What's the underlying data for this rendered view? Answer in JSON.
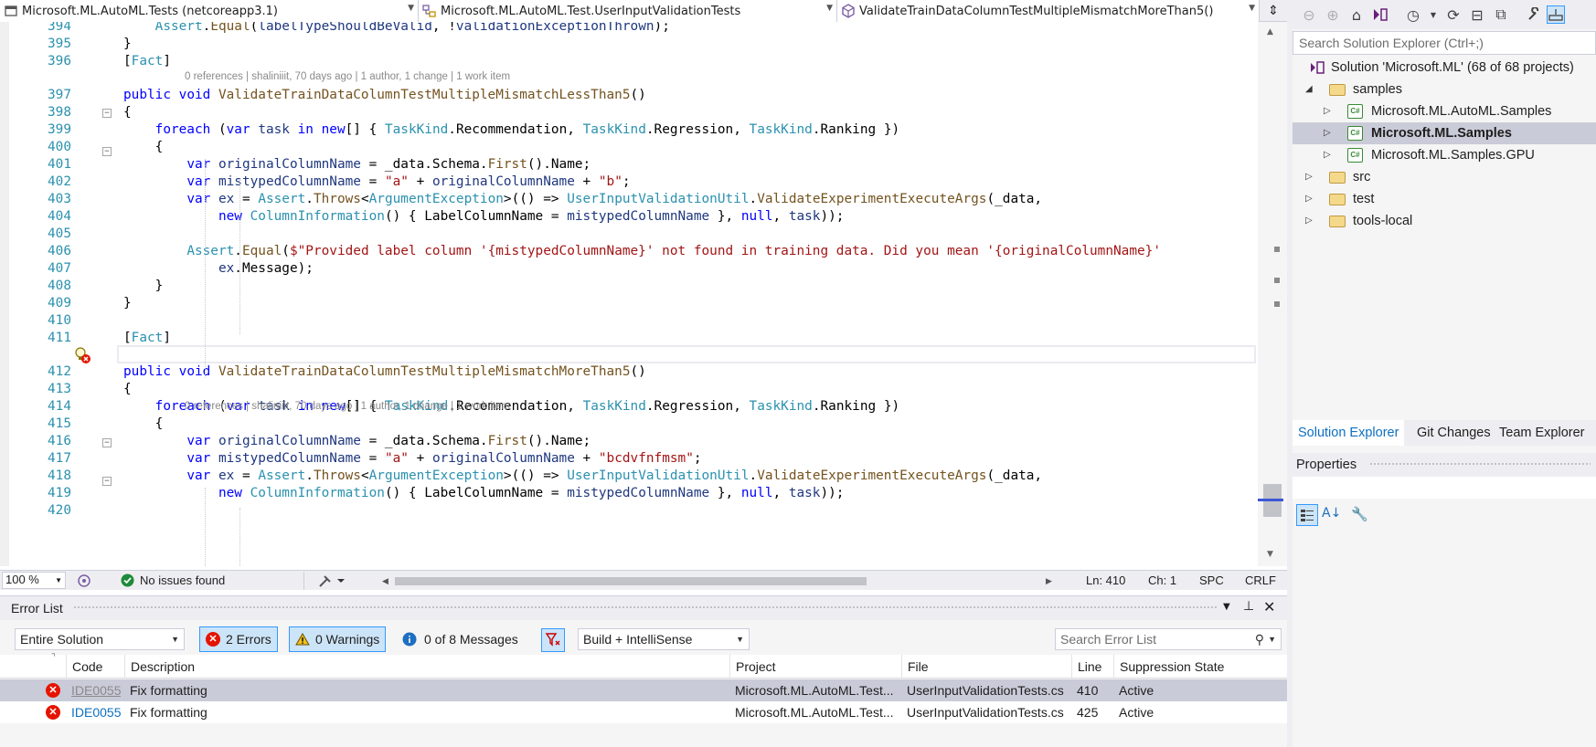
{
  "nav_bar": {
    "project": "Microsoft.ML.AutoML.Tests (netcoreapp3.1)",
    "class": "Microsoft.ML.AutoML.Test.UserInputValidationTests",
    "member": "ValidateTrainDataColumnTestMultipleMismatchMoreThan5()"
  },
  "editor": {
    "lines": [
      {
        "n": "394",
        "code": "            Assert.Equal(labelTypeShouldBeValid, !validationExceptionThrown);"
      },
      {
        "n": "395",
        "code": "        }"
      },
      {
        "n": "396",
        "code": "        [Fact]"
      },
      {
        "n": "397",
        "code": "        public void ValidateTrainDataColumnTestMultipleMismatchLessThan5()"
      },
      {
        "n": "398",
        "code": "        {"
      },
      {
        "n": "399",
        "code": "            foreach (var task in new[] { TaskKind.Recommendation, TaskKind.Regression, TaskKind.Ranking })"
      },
      {
        "n": "400",
        "code": "            {"
      },
      {
        "n": "401",
        "code": "                var originalColumnName = _data.Schema.First().Name;"
      },
      {
        "n": "402",
        "code": "                var mistypedColumnName = \"a\" + originalColumnName + \"b\";"
      },
      {
        "n": "403",
        "code": "                var ex = Assert.Throws<ArgumentException>(() => UserInputValidationUtil.ValidateExperimentExecuteArgs(_data,"
      },
      {
        "n": "404",
        "code": "                    new ColumnInformation() { LabelColumnName = mistypedColumnName }, null, task));"
      },
      {
        "n": "405",
        "code": ""
      },
      {
        "n": "406",
        "code": "                Assert.Equal($\"Provided label column '{mistypedColumnName}' not found in training data. Did you mean '{originalColumnName}'"
      },
      {
        "n": "407",
        "code": "                    ex.Message);"
      },
      {
        "n": "408",
        "code": "            }"
      },
      {
        "n": "409",
        "code": "        }"
      },
      {
        "n": "410",
        "code": ""
      },
      {
        "n": "411",
        "code": "        [Fact]"
      },
      {
        "n": "412",
        "code": "        public void ValidateTrainDataColumnTestMultipleMismatchMoreThan5()"
      },
      {
        "n": "413",
        "code": "        {"
      },
      {
        "n": "414",
        "code": "            foreach (var task in new[] { TaskKind.Recommendation, TaskKind.Regression, TaskKind.Ranking })"
      },
      {
        "n": "415",
        "code": "            {"
      },
      {
        "n": "416",
        "code": "                var originalColumnName = _data.Schema.First().Name;"
      },
      {
        "n": "417",
        "code": "                var mistypedColumnName = \"a\" + originalColumnName + \"bcdvfnfmsm\";"
      },
      {
        "n": "418",
        "code": "                var ex = Assert.Throws<ArgumentException>(() => UserInputValidationUtil.ValidateExperimentExecuteArgs(_data,"
      },
      {
        "n": "419",
        "code": "                    new ColumnInformation() { LabelColumnName = mistypedColumnName }, null, task));"
      },
      {
        "n": "420",
        "code": ""
      }
    ],
    "codelens": "0 references | shaliniiit, 70 days ago | 1 author, 1 change | 1 work item"
  },
  "status": {
    "zoom": "100 %",
    "issues": "No issues found",
    "line": "Ln: 410",
    "col": "Ch: 1",
    "whitespace": "SPC",
    "eol": "CRLF"
  },
  "error_list": {
    "title": "Error List",
    "scope": "Entire Solution",
    "errors_label": "2 Errors",
    "warnings_label": "0 Warnings",
    "messages_label": "0 of 8 Messages",
    "build_filter": "Build + IntelliSense",
    "search_placeholder": "Search Error List",
    "columns": {
      "code": "Code",
      "description": "Description",
      "project": "Project",
      "file": "File",
      "line": "Line",
      "suppression": "Suppression State"
    },
    "rows": [
      {
        "code": "IDE0055",
        "description": "Fix formatting",
        "project": "Microsoft.ML.AutoML.Test...",
        "file": "UserInputValidationTests.cs",
        "line": "410",
        "state": "Active"
      },
      {
        "code": "IDE0055",
        "description": "Fix formatting",
        "project": "Microsoft.ML.AutoML.Test...",
        "file": "UserInputValidationTests.cs",
        "line": "425",
        "state": "Active"
      }
    ]
  },
  "solution_explorer": {
    "search_placeholder": "Search Solution Explorer (Ctrl+;)",
    "solution": "Solution 'Microsoft.ML' (68 of 68 projects)",
    "samples": "samples",
    "proj_automl_samples": "Microsoft.ML.AutoML.Samples",
    "proj_samples": "Microsoft.ML.Samples",
    "proj_samples_gpu": "Microsoft.ML.Samples.GPU",
    "folder_src": "src",
    "folder_test": "test",
    "folder_tools": "tools-local",
    "tabs": {
      "solution": "Solution Explorer",
      "git": "Git Changes",
      "team": "Team Explorer"
    }
  },
  "properties": {
    "title": "Properties"
  },
  "colors": {
    "accent": "#0e70c0",
    "error": "#e51400",
    "selection": "#cacbd8",
    "line_number": "#2b91af"
  }
}
